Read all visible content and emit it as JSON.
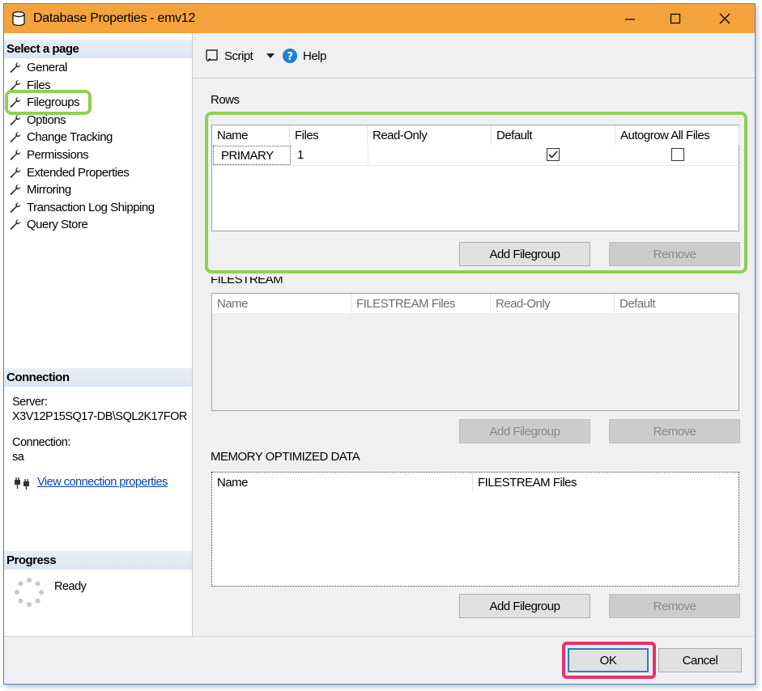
{
  "window": {
    "title": "Database Properties - emv12",
    "controls": {
      "minimize": "minimize",
      "maximize": "maximize",
      "close": "close"
    }
  },
  "left": {
    "select_page_header": "Select a page",
    "pages": [
      {
        "label": "General"
      },
      {
        "label": "Files"
      },
      {
        "label": "Filegroups"
      },
      {
        "label": "Options"
      },
      {
        "label": "Change Tracking"
      },
      {
        "label": "Permissions"
      },
      {
        "label": "Extended Properties"
      },
      {
        "label": "Mirroring"
      },
      {
        "label": "Transaction Log Shipping"
      },
      {
        "label": "Query Store"
      }
    ],
    "selected_page": "Filegroups",
    "connection_header": "Connection",
    "server_label": "Server:",
    "server_value": "X3V12P15SQ17-DB\\SQL2K17FOR",
    "connection_label": "Connection:",
    "connection_value": "sa",
    "view_connection_link": "View connection properties",
    "progress_header": "Progress",
    "progress_status": "Ready"
  },
  "toolbar": {
    "script_label": "Script",
    "help_label": "Help"
  },
  "rows_section": {
    "title": "Rows",
    "columns": [
      "Name",
      "Files",
      "Read-Only",
      "Default",
      "Autogrow All Files"
    ],
    "rows": [
      {
        "name": "PRIMARY",
        "files": "1",
        "read_only": "",
        "default": true,
        "autogrow_all_files": false
      }
    ],
    "add_button": "Add Filegroup",
    "remove_button": "Remove"
  },
  "filestream_section": {
    "title": "FILESTREAM",
    "columns": [
      "Name",
      "FILESTREAM Files",
      "Read-Only",
      "Default"
    ],
    "add_button": "Add Filegroup",
    "remove_button": "Remove"
  },
  "memory_section": {
    "title": "MEMORY OPTIMIZED DATA",
    "columns": [
      "Name",
      "FILESTREAM Files"
    ],
    "add_button": "Add Filegroup",
    "remove_button": "Remove"
  },
  "footer": {
    "ok_button": "OK",
    "cancel_button": "Cancel"
  },
  "colors": {
    "titlebar": "#f4a33c",
    "green_highlight": "#8fd14f",
    "pink_highlight": "#e8316e",
    "link": "#0645ad"
  }
}
